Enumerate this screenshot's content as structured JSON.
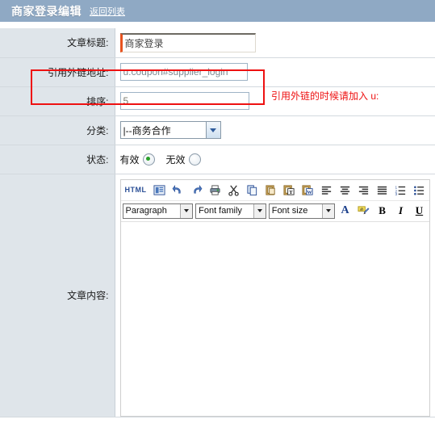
{
  "header": {
    "title": "商家登录编辑",
    "back_link": "返回列表",
    "bg_color": "#8fa9c4"
  },
  "annotation": {
    "hint_text": "引用外链的时候请加入 u:",
    "hint_color": "#ee1111",
    "box_color": "#ee1111"
  },
  "form": {
    "rows": [
      {
        "label": "文章标题:",
        "value": "商家登录"
      },
      {
        "label": "引用外链地址:",
        "value": "u:coupon#supplier_login"
      },
      {
        "label": "排序:",
        "value": "5"
      },
      {
        "label": "分类:",
        "value": "|--商务合作"
      },
      {
        "label": "状态:",
        "value": "有效"
      },
      {
        "label": "文章内容:",
        "value": ""
      }
    ],
    "title_label": "文章标题:",
    "title_value": "商家登录",
    "link_label": "引用外链地址:",
    "link_value": "u:coupon#supplier_login",
    "order_label": "排序:",
    "order_value": "5",
    "category_label": "分类:",
    "category_value": "|--商务合作",
    "status_label": "状态:",
    "status_enabled_label": "有效",
    "status_disabled_label": "无效",
    "status_selected": "有效",
    "content_label": "文章内容:"
  },
  "editor": {
    "html_label": "HTML",
    "toolbar_row1": [
      {
        "name": "html-source-button",
        "label": "HTML"
      },
      {
        "name": "preview-icon",
        "label": ""
      },
      {
        "name": "undo-icon",
        "label": ""
      },
      {
        "name": "redo-icon",
        "label": ""
      },
      {
        "name": "print-icon",
        "label": ""
      },
      {
        "name": "cut-icon",
        "label": ""
      },
      {
        "name": "copy-icon",
        "label": ""
      },
      {
        "name": "paste-icon",
        "label": ""
      },
      {
        "name": "paste-as-text-icon",
        "label": "T"
      },
      {
        "name": "paste-from-word-icon",
        "label": "W"
      },
      {
        "name": "align-left-icon",
        "label": ""
      },
      {
        "name": "align-center-icon",
        "label": ""
      },
      {
        "name": "align-right-icon",
        "label": ""
      },
      {
        "name": "align-justify-icon",
        "label": ""
      },
      {
        "name": "numbered-list-icon",
        "label": ""
      },
      {
        "name": "bullet-list-icon",
        "label": ""
      }
    ],
    "paragraph_select": "Paragraph",
    "font_family_select": "Font family",
    "font_size_select": "Font size",
    "text_color_label": "A",
    "bold_label": "B",
    "italic_label": "I",
    "underline_label": "U",
    "content_value": ""
  }
}
